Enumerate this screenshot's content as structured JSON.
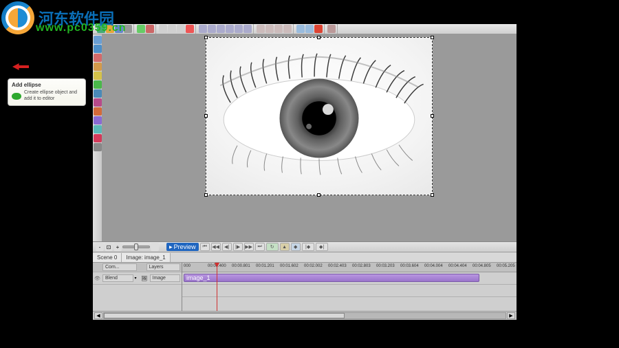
{
  "watermark": {
    "site_name": "河东软件园",
    "url": "www.pc0359.cn"
  },
  "tooltip": {
    "title": "Add ellipse",
    "desc": "Create ellipse object and add it to editor"
  },
  "top_toolbar": {
    "groups": [
      [
        "file-new",
        "file-open",
        "save",
        "revert"
      ],
      [
        "undo",
        "redo"
      ],
      [
        "cut",
        "copy",
        "paste",
        "delete"
      ],
      [
        "align-left",
        "align-center",
        "align-right",
        "align-top",
        "align-middle",
        "align-bottom"
      ],
      [
        "group",
        "ungroup",
        "bring-front",
        "send-back"
      ],
      [
        "snap",
        "grid",
        "guides"
      ],
      [
        "settings"
      ]
    ],
    "colors": [
      "#4a7",
      "#e55",
      "#68c",
      "#999",
      "#e5a63a",
      "#6c6",
      "#c66",
      "#d0d0d0",
      "#d0d0d0",
      "#aac",
      "#aac",
      "#aac",
      "#aac",
      "#aac",
      "#aac",
      "#cbb",
      "#cbb",
      "#cbb",
      "#cbb",
      "#9bd",
      "#9bd",
      "#9bd",
      "#b99"
    ]
  },
  "left_toolbar": {
    "items": [
      {
        "name": "pointer",
        "color": "#6a9fd4"
      },
      {
        "name": "text",
        "color": "#4d8fc9"
      },
      {
        "name": "image",
        "color": "#d46a6a"
      },
      {
        "name": "video",
        "color": "#d49a4a"
      },
      {
        "name": "add-rectangle",
        "color": "#d4c24a"
      },
      {
        "name": "add-ellipse",
        "color": "#4ab84a"
      },
      {
        "name": "add-line",
        "color": "#4a8ab8"
      },
      {
        "name": "freeform",
        "color": "#b84a8a"
      },
      {
        "name": "chart",
        "color": "#d46a3a"
      },
      {
        "name": "animation",
        "color": "#8a6ad4"
      },
      {
        "name": "counter",
        "color": "#5ab8b8"
      },
      {
        "name": "audio",
        "color": "#d43a5a"
      },
      {
        "name": "button",
        "color": "#888"
      }
    ]
  },
  "transport": {
    "preview_label": "Preview"
  },
  "scene": {
    "tab1": "Scene 0",
    "tab2": "Image: image_1"
  },
  "ruler": {
    "ticks": [
      "000",
      "00:00.400",
      "00:00.801",
      "00:01.201",
      "00:01.602",
      "00:02.002",
      "00:02.403",
      "00:02.803",
      "00:03.203",
      "00:03.604",
      "00:04.004",
      "00:04.404",
      "00:04.805",
      "00:05.205"
    ]
  },
  "timeline": {
    "col_headers": {
      "compose": "Com...",
      "layers": "Layers"
    },
    "row": {
      "mode": "Blend",
      "type": "Image"
    },
    "clip_label": "image_1"
  }
}
